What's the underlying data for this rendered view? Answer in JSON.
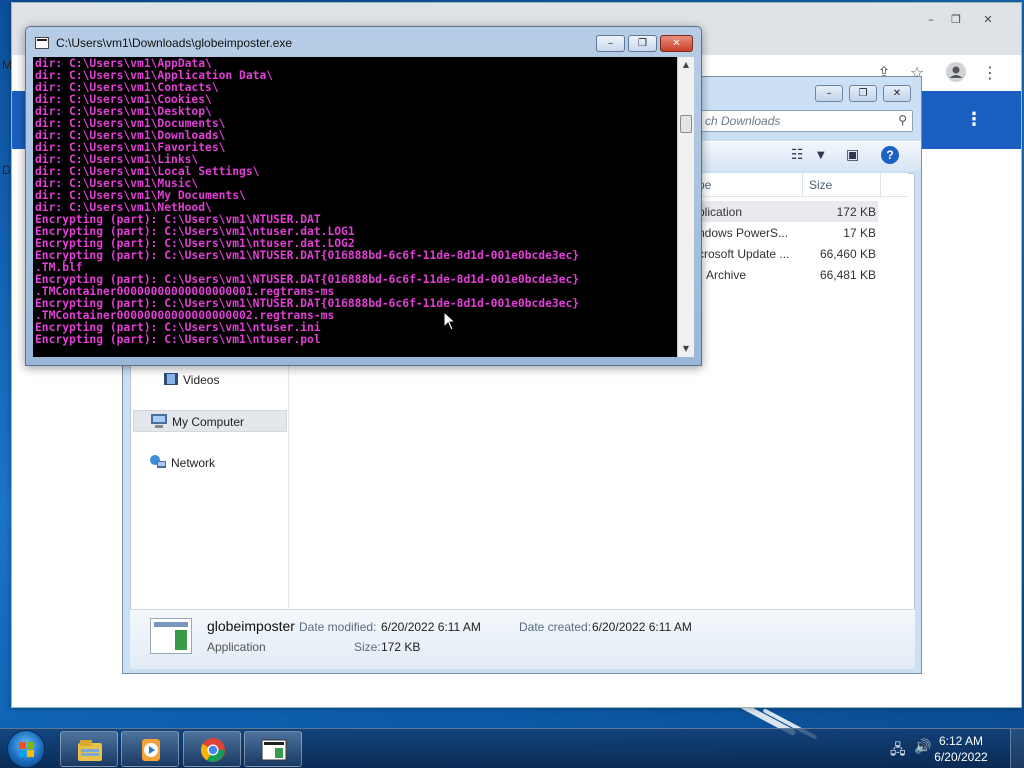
{
  "chrome": {
    "left_edge_letters": [
      "M",
      "D"
    ],
    "controls": {
      "minimize": "–",
      "maximize": "❐",
      "close": "✕"
    },
    "icons": [
      "share-icon",
      "star-icon",
      "profile-icon",
      "kebab-menu-icon"
    ]
  },
  "explorer": {
    "search_placeholder": "Search Downloads",
    "search_visible_text": "ch Downloads",
    "columns": {
      "type": "pe",
      "size": "Size"
    },
    "files": [
      {
        "type": "plication",
        "size": "172 KB",
        "selected": true
      },
      {
        "type": "ndows PowerS...",
        "size": "17 KB",
        "selected": false
      },
      {
        "type": "crosoft Update ...",
        "size": "66,460 KB",
        "selected": false
      },
      {
        "type": "Archive",
        "size": "66,481 KB",
        "selected": false
      }
    ],
    "nav": [
      {
        "label": "Videos",
        "icon": "videos-icon",
        "selected": false
      },
      {
        "label": "My Computer",
        "icon": "computer-icon",
        "selected": true
      },
      {
        "label": "Network",
        "icon": "network-icon",
        "selected": false
      }
    ],
    "details": {
      "name": "globeimposter",
      "type": "Application",
      "modified_label": "Date modified:",
      "modified_value": "6/20/2022 6:11 AM",
      "created_label": "Date created:",
      "created_value": "6/20/2022 6:11 AM",
      "size_label": "Size:",
      "size_value": "172 KB"
    }
  },
  "console": {
    "title": "C:\\Users\\vm1\\Downloads\\globeimposter.exe",
    "text_color": "#e23fd6",
    "lines": [
      "dir: C:\\Users\\vm1\\AppData\\",
      "dir: C:\\Users\\vm1\\Application Data\\",
      "dir: C:\\Users\\vm1\\Contacts\\",
      "dir: C:\\Users\\vm1\\Cookies\\",
      "dir: C:\\Users\\vm1\\Desktop\\",
      "dir: C:\\Users\\vm1\\Documents\\",
      "dir: C:\\Users\\vm1\\Downloads\\",
      "dir: C:\\Users\\vm1\\Favorites\\",
      "dir: C:\\Users\\vm1\\Links\\",
      "dir: C:\\Users\\vm1\\Local Settings\\",
      "dir: C:\\Users\\vm1\\Music\\",
      "dir: C:\\Users\\vm1\\My Documents\\",
      "dir: C:\\Users\\vm1\\NetHood\\",
      "Encrypting (part): C:\\Users\\vm1\\NTUSER.DAT",
      "Encrypting (part): C:\\Users\\vm1\\ntuser.dat.LOG1",
      "Encrypting (part): C:\\Users\\vm1\\ntuser.dat.LOG2",
      "Encrypting (part): C:\\Users\\vm1\\NTUSER.DAT{016888bd-6c6f-11de-8d1d-001e0bcde3ec}",
      ".TM.blf",
      "Encrypting (part): C:\\Users\\vm1\\NTUSER.DAT{016888bd-6c6f-11de-8d1d-001e0bcde3ec}",
      ".TMContainer00000000000000000001.regtrans-ms",
      "Encrypting (part): C:\\Users\\vm1\\NTUSER.DAT{016888bd-6c6f-11de-8d1d-001e0bcde3ec}",
      ".TMContainer00000000000000000002.regtrans-ms",
      "Encrypting (part): C:\\Users\\vm1\\ntuser.ini",
      "Encrypting (part): C:\\Users\\vm1\\ntuser.pol"
    ]
  },
  "taskbar": {
    "buttons": [
      "windows-explorer-icon",
      "media-player-icon",
      "chrome-icon",
      "console-app-icon"
    ],
    "clock_time": "6:12 AM",
    "clock_date": "6/20/2022"
  }
}
